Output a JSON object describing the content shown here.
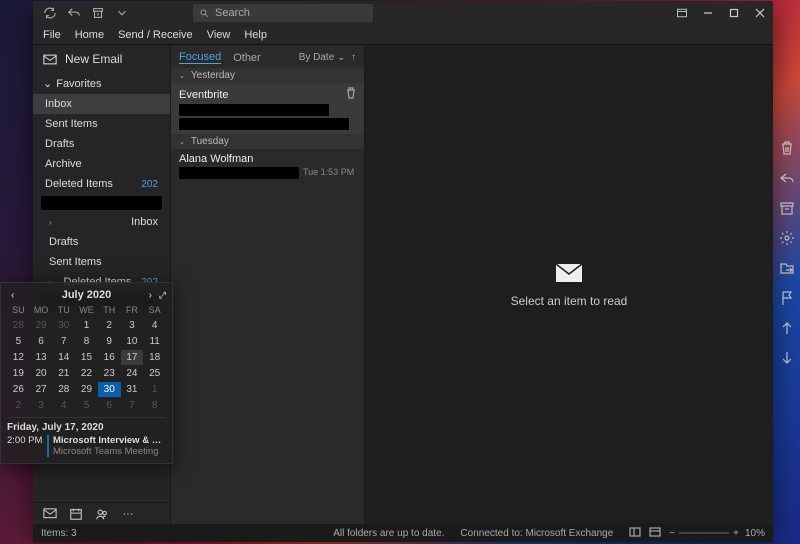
{
  "titlebar": {
    "search_placeholder": "Search"
  },
  "menu": [
    "File",
    "Home",
    "Send / Receive",
    "View",
    "Help"
  ],
  "new_email_label": "New Email",
  "favorites_label": "Favorites",
  "folders": {
    "inbox": "Inbox",
    "sent": "Sent Items",
    "drafts": "Drafts",
    "archive": "Archive",
    "deleted": "Deleted Items",
    "deleted_count": "202"
  },
  "folders2": {
    "inbox": "Inbox",
    "drafts": "Drafts",
    "sent": "Sent Items",
    "deleted": "Deleted Items",
    "deleted_count": "202"
  },
  "msglist": {
    "tab_focused": "Focused",
    "tab_other": "Other",
    "bydate": "By Date",
    "group1": "Yesterday",
    "sender1": "Eventbrite",
    "group2": "Tuesday",
    "sender2": "Alana Wolfman",
    "time2": "Tue 1:53 PM"
  },
  "reading_prompt": "Select an item to read",
  "calendar": {
    "title": "July 2020",
    "dow": [
      "SU",
      "MO",
      "TU",
      "WE",
      "TH",
      "FR",
      "SA"
    ],
    "weeks": [
      [
        {
          "d": "28",
          "o": true
        },
        {
          "d": "29",
          "o": true
        },
        {
          "d": "30",
          "o": true
        },
        {
          "d": "1"
        },
        {
          "d": "2"
        },
        {
          "d": "3"
        },
        {
          "d": "4"
        }
      ],
      [
        {
          "d": "5"
        },
        {
          "d": "6"
        },
        {
          "d": "7"
        },
        {
          "d": "8"
        },
        {
          "d": "9"
        },
        {
          "d": "10"
        },
        {
          "d": "11"
        }
      ],
      [
        {
          "d": "12"
        },
        {
          "d": "13"
        },
        {
          "d": "14"
        },
        {
          "d": "15"
        },
        {
          "d": "16"
        },
        {
          "d": "17",
          "hl": true
        },
        {
          "d": "18"
        }
      ],
      [
        {
          "d": "19"
        },
        {
          "d": "20"
        },
        {
          "d": "21"
        },
        {
          "d": "22"
        },
        {
          "d": "23"
        },
        {
          "d": "24"
        },
        {
          "d": "25"
        }
      ],
      [
        {
          "d": "26"
        },
        {
          "d": "27"
        },
        {
          "d": "28"
        },
        {
          "d": "29"
        },
        {
          "d": "30",
          "today": true
        },
        {
          "d": "31"
        },
        {
          "d": "1",
          "o": true
        }
      ],
      [
        {
          "d": "2",
          "o": true
        },
        {
          "d": "3",
          "o": true
        },
        {
          "d": "4",
          "o": true
        },
        {
          "d": "5",
          "o": true
        },
        {
          "d": "6",
          "o": true
        },
        {
          "d": "7",
          "o": true
        },
        {
          "d": "8",
          "o": true
        }
      ]
    ],
    "agenda_date": "Friday, July 17, 2020",
    "agenda_time": "2:00 PM",
    "agenda_title": "Microsoft Interview & demo w/ Set...",
    "agenda_sub": "Microsoft Teams Meeting"
  },
  "status": {
    "items": "Items: 3",
    "sync": "All folders are up to date.",
    "conn": "Connected to: Microsoft Exchange",
    "zoom": "10%"
  }
}
